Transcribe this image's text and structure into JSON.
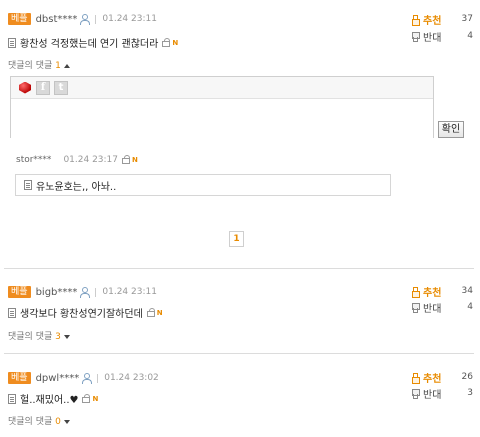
{
  "comments": [
    {
      "badge": "베플",
      "user": "dbst****",
      "date": "01.24 23:11",
      "text": "황찬성 걱정했는데 연기 괜찮더라",
      "new_mark": "N",
      "replies_label": "댓글의 댓글",
      "replies_count": "1",
      "replies_open": true,
      "up_label": "추천",
      "up_count": "37",
      "down_label": "반대",
      "down_count": "4"
    },
    {
      "badge": "베플",
      "user": "bigb****",
      "date": "01.24 23:11",
      "text": "생각보다 황찬성연기잘하던데",
      "new_mark": "N",
      "replies_label": "댓글의 댓글",
      "replies_count": "3",
      "replies_open": false,
      "up_label": "추천",
      "up_count": "34",
      "down_label": "반대",
      "down_count": "4"
    },
    {
      "badge": "베플",
      "user": "dpwl****",
      "date": "01.24 23:02",
      "text": "헐..재밌어..♥",
      "new_mark": "N",
      "replies_label": "댓글의 댓글",
      "replies_count": "0",
      "replies_open": false,
      "up_label": "추천",
      "up_count": "26",
      "down_label": "반대",
      "down_count": "3"
    }
  ],
  "reply_editor": {
    "share_facebook": "f",
    "share_twitter": "t",
    "placeholder": "",
    "submit_label": "확인"
  },
  "reply": {
    "user": "stor****",
    "date": "01.24 23:17",
    "new_mark": "N",
    "text": "유노윤호는,, 아놔.."
  },
  "pagination": {
    "current_page": "1"
  },
  "colors": {
    "accent": "#e88b00",
    "badge": "#ef8c1f",
    "divider": "#dcdcdc"
  },
  "icons": {
    "user": "person-icon",
    "document": "document-icon",
    "lock": "lock-icon",
    "recommend": "thumbs-up-icon",
    "oppose": "thumbs-down-icon",
    "share_gem": "red-gem-icon",
    "share_facebook": "facebook-icon",
    "share_twitter": "twitter-icon"
  }
}
